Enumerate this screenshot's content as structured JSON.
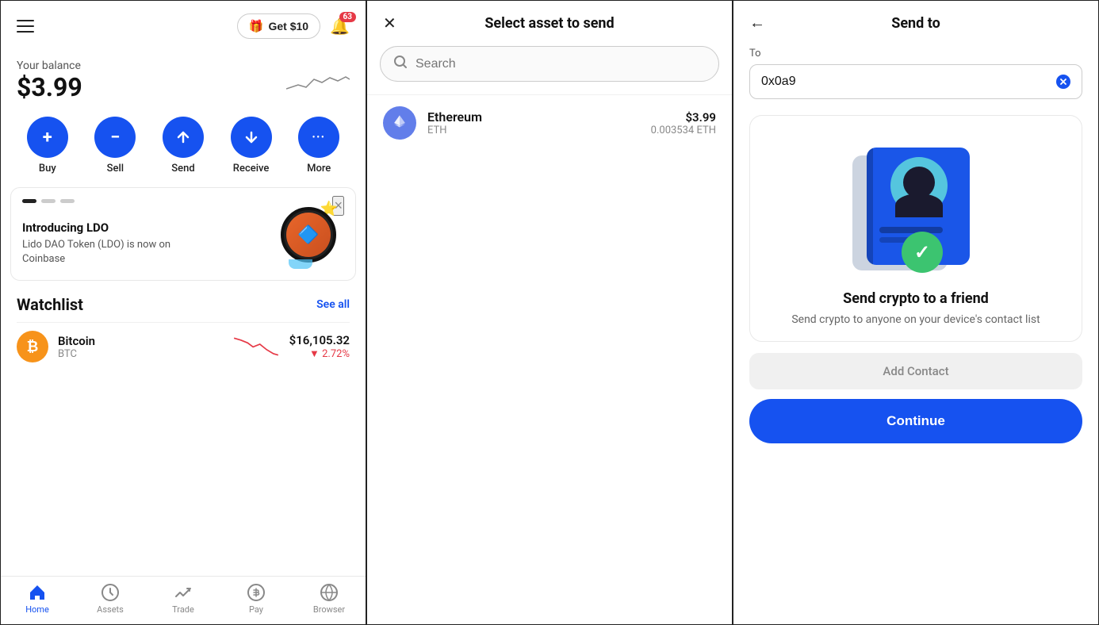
{
  "left": {
    "header": {
      "get_btn": "Get $10",
      "notif_count": "63"
    },
    "balance": {
      "label": "Your balance",
      "amount": "$3.99"
    },
    "actions": [
      {
        "id": "buy",
        "label": "Buy",
        "icon": "+"
      },
      {
        "id": "sell",
        "label": "Sell",
        "icon": "−"
      },
      {
        "id": "send",
        "label": "Send",
        "icon": "↑"
      },
      {
        "id": "receive",
        "label": "Receive",
        "icon": "↓"
      },
      {
        "id": "more",
        "label": "More",
        "icon": "···"
      }
    ],
    "promo": {
      "title": "Introducing LDO",
      "desc": "Lido DAO Token (LDO) is now on Coinbase"
    },
    "watchlist": {
      "title": "Watchlist",
      "see_all": "See all",
      "items": [
        {
          "name": "Bitcoin",
          "symbol": "BTC",
          "price": "$16,105.32",
          "change": "▼ 2.72%"
        }
      ]
    },
    "nav": [
      {
        "id": "home",
        "label": "Home",
        "active": true
      },
      {
        "id": "assets",
        "label": "Assets",
        "active": false
      },
      {
        "id": "trade",
        "label": "Trade",
        "active": false
      },
      {
        "id": "pay",
        "label": "Pay",
        "active": false
      },
      {
        "id": "browser",
        "label": "Browser",
        "active": false
      }
    ]
  },
  "middle": {
    "title": "Select asset to send",
    "search_placeholder": "Search",
    "asset": {
      "name": "Ethereum",
      "symbol": "ETH",
      "usd": "$3.99",
      "crypto": "0.003534 ETH"
    }
  },
  "right": {
    "title": "Send to",
    "to_label": "To",
    "to_value": "0x0a9",
    "send_friend_title": "Send crypto to a friend",
    "send_friend_desc": "Send crypto to anyone on your device's contact list",
    "add_contact_label": "Add Contact",
    "continue_label": "Continue"
  }
}
